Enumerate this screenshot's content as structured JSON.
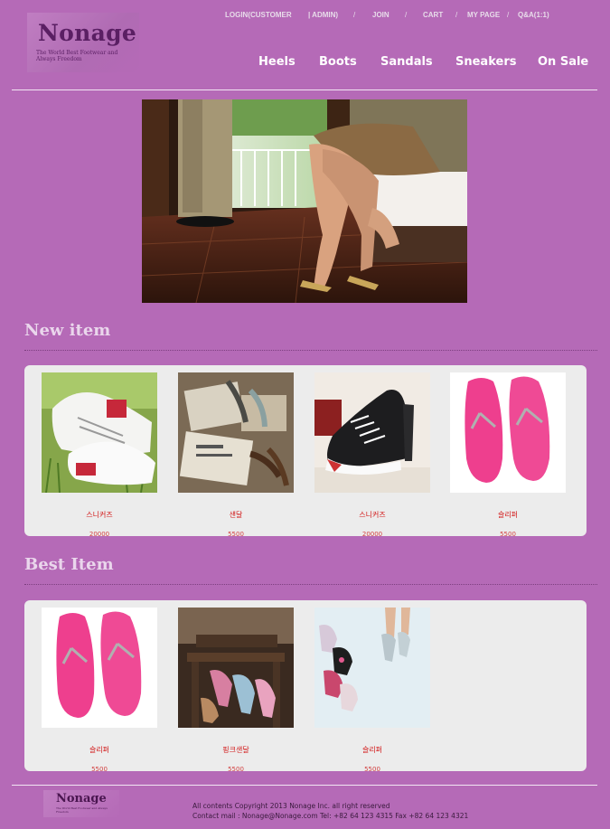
{
  "brand": {
    "name": "Nonage",
    "tagline": "The World Best Footwear and Always Freedom"
  },
  "top_links": [
    {
      "label": "LOGIN(CUSTOMER"
    },
    {
      "label": "| ADMIN)"
    },
    {
      "label": "JOIN"
    },
    {
      "label": "CART"
    },
    {
      "label": "MY PAGE"
    },
    {
      "label": "Q&A(1:1)"
    }
  ],
  "top_separator": "/",
  "nav": [
    {
      "label": "Heels"
    },
    {
      "label": "Boots"
    },
    {
      "label": "Sandals"
    },
    {
      "label": "Sneakers"
    },
    {
      "label": "On Sale"
    }
  ],
  "sections": {
    "new": {
      "title": "New item",
      "items": [
        {
          "name": "스니커즈",
          "price": "20000"
        },
        {
          "name": "샌달",
          "price": "5500"
        },
        {
          "name": "스니커즈",
          "price": "20000"
        },
        {
          "name": "슬리퍼",
          "price": "5500"
        }
      ]
    },
    "best": {
      "title": "Best Item",
      "items": [
        {
          "name": "슬리퍼",
          "price": "5500"
        },
        {
          "name": "핑크샌달",
          "price": "5500"
        },
        {
          "name": "슬리퍼",
          "price": "5500"
        }
      ]
    }
  },
  "footer": {
    "copyright": "All contents Copyright 2013 Nonage Inc. all right reserved",
    "contact": "Contact mail : Nonage@Nonage.com Tel: +82 64 123 4315 Fax +82 64 123 4321"
  },
  "colors": {
    "background": "#b56ab7",
    "panel": "#ececec",
    "product_text": "#d21717",
    "brand": "#5a1f63"
  }
}
